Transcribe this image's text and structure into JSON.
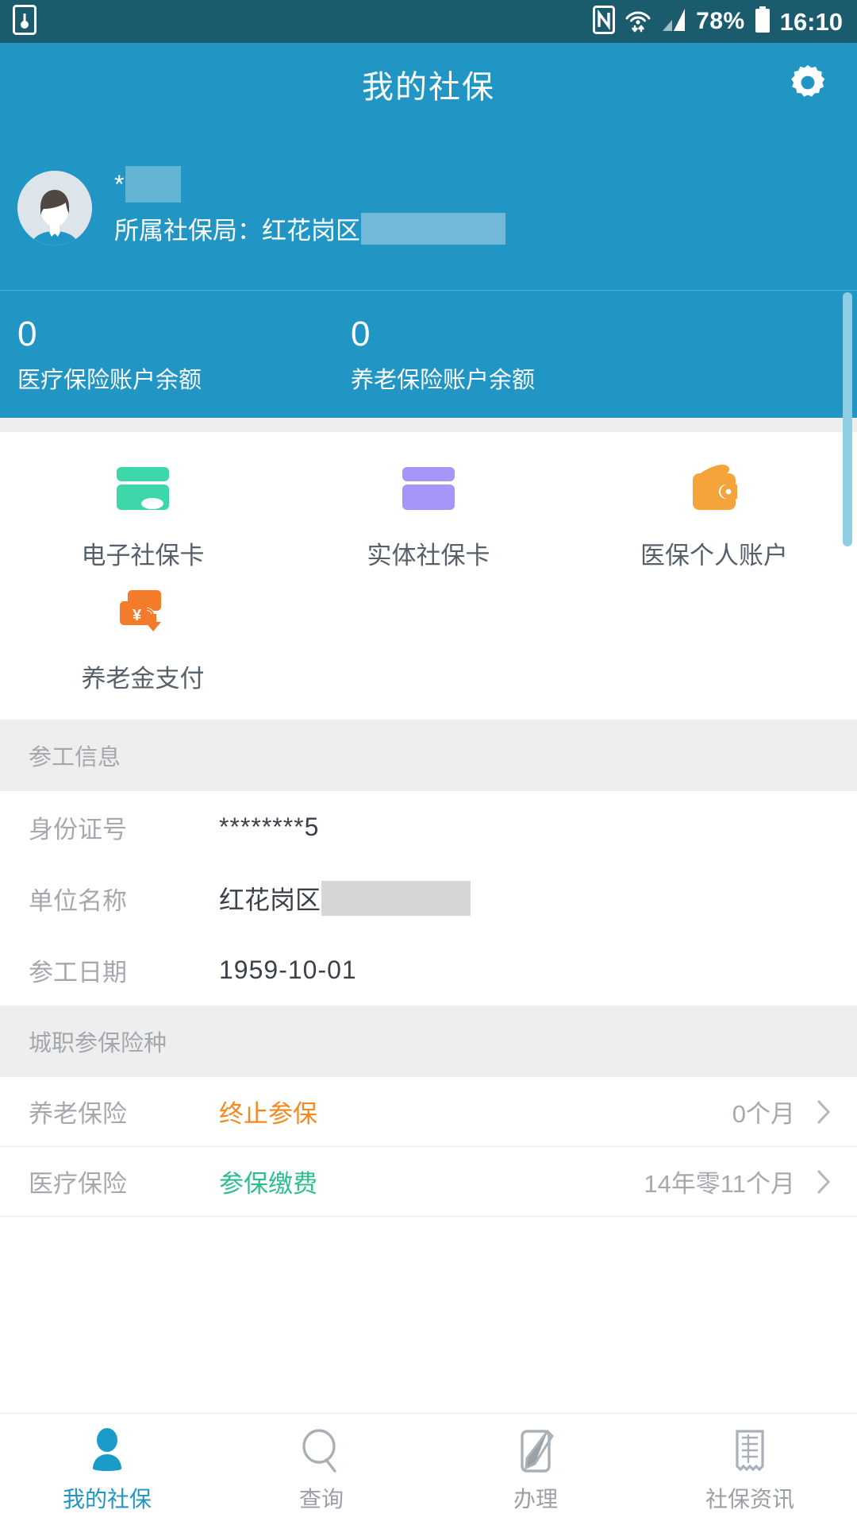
{
  "statusbar": {
    "battery_percent": "78%",
    "time": "16:10",
    "icons": [
      "screen-record-icon",
      "nfc-icon",
      "wifi-icon",
      "cellular-signal-icon",
      "battery-icon"
    ]
  },
  "appbar": {
    "title": "我的社保",
    "settings_icon": "gear-icon"
  },
  "profile": {
    "name": "*",
    "name_redacted": true,
    "bureau_label": "所属社保局：红花岗区",
    "bureau_redacted": true,
    "avatar_icon": "user-avatar"
  },
  "balances": [
    {
      "value": "0",
      "label": "医疗保险账户余额"
    },
    {
      "value": "0",
      "label": "养老保险账户余额"
    }
  ],
  "shortcuts": [
    {
      "label": "电子社保卡",
      "icon": "card-cloud-icon",
      "color": "#3ed6ab"
    },
    {
      "label": "实体社保卡",
      "icon": "card-icon",
      "color": "#a597f7"
    },
    {
      "label": "医保个人账户",
      "icon": "wallet-icon",
      "color": "#f5a43c"
    },
    {
      "label": "养老金支付",
      "icon": "card-yen-download-icon",
      "color": "#f47b2a"
    }
  ],
  "work_info": {
    "header": "参工信息",
    "rows": [
      {
        "label": "身份证号",
        "value": "********5",
        "redacted": false
      },
      {
        "label": "单位名称",
        "value": "红花岗区",
        "redacted": true
      },
      {
        "label": "参工日期",
        "value": "1959-10-01",
        "redacted": false
      }
    ]
  },
  "insurance": {
    "header": "城职参保险种",
    "rows": [
      {
        "name": "养老保险",
        "status": "终止参保",
        "status_color": "#f5881f",
        "duration": "0个月"
      },
      {
        "name": "医疗保险",
        "status": "参保缴费",
        "status_color": "#2bbf8f",
        "duration": "14年零11个月"
      }
    ]
  },
  "tabbar": {
    "items": [
      {
        "label": "我的社保",
        "icon": "person-icon",
        "active": true
      },
      {
        "label": "查询",
        "icon": "search-icon",
        "active": false
      },
      {
        "label": "办理",
        "icon": "pencil-edit-icon",
        "active": false
      },
      {
        "label": "社保资讯",
        "icon": "receipt-icon",
        "active": false
      }
    ]
  },
  "colors": {
    "brand_blue": "#2196c4",
    "statusbar_blue": "#1a5c6e",
    "section_gray": "#eeeeee"
  }
}
